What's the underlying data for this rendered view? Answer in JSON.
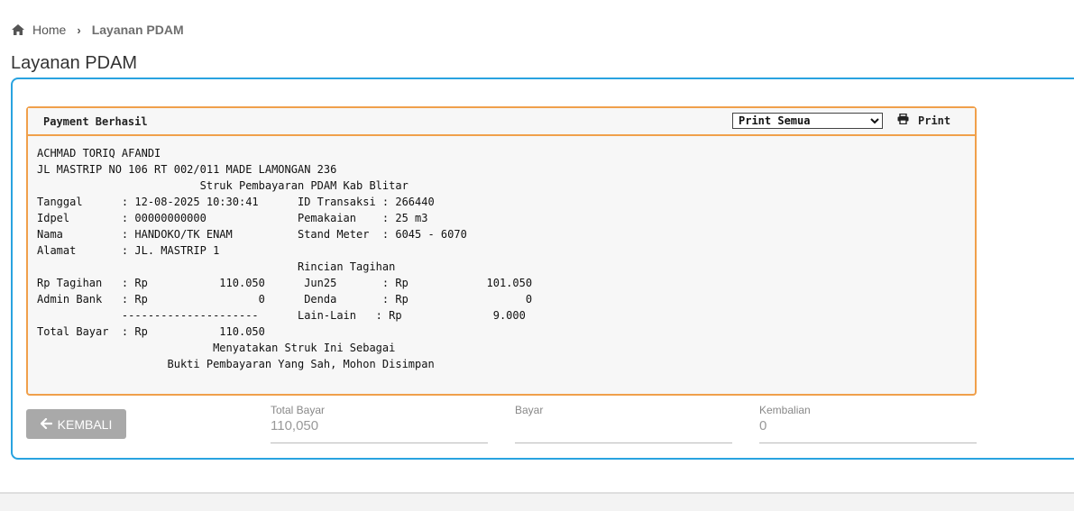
{
  "breadcrumb": {
    "home": "Home",
    "current": "Layanan PDAM"
  },
  "page_title": "Layanan PDAM",
  "receipt": {
    "header_title": "Payment Berhasil",
    "print_select_value": "Print Semua",
    "print_label": "Print",
    "lines": [
      "ACHMAD TORIQ AFANDI",
      "JL MASTRIP NO 106 RT 002/011 MADE LAMONGAN 236",
      "                         Struk Pembayaran PDAM Kab Blitar",
      "Tanggal      : 12-08-2025 10:30:41      ID Transaksi : 266440",
      "Idpel        : 00000000000              Pemakaian    : 25 m3",
      "Nama         : HANDOKO/TK ENAM          Stand Meter  : 6045 - 6070",
      "Alamat       : JL. MASTRIP 1",
      "                                        Rincian Tagihan",
      "Rp Tagihan   : Rp           110.050      Jun25       : Rp            101.050",
      "Admin Bank   : Rp                 0      Denda       : Rp                  0",
      "             ---------------------      Lain-Lain   : Rp              9.000",
      "Total Bayar  : Rp           110.050",
      "                           Menyatakan Struk Ini Sebagai",
      "                    Bukti Pembayaran Yang Sah, Mohon Disimpan"
    ]
  },
  "back_button": {
    "label": "KEMBALI",
    "icon": "arrow-left-icon"
  },
  "fields": {
    "total_bayar": {
      "label": "Total Bayar",
      "value": "110,050"
    },
    "bayar": {
      "label": "Bayar",
      "value": ""
    },
    "kembalian": {
      "label": "Kembalian",
      "value": "0"
    }
  },
  "colors": {
    "panel_border": "#29a3e0",
    "receipt_border": "#f0a04b",
    "button_bg": "#a9a9a9"
  }
}
